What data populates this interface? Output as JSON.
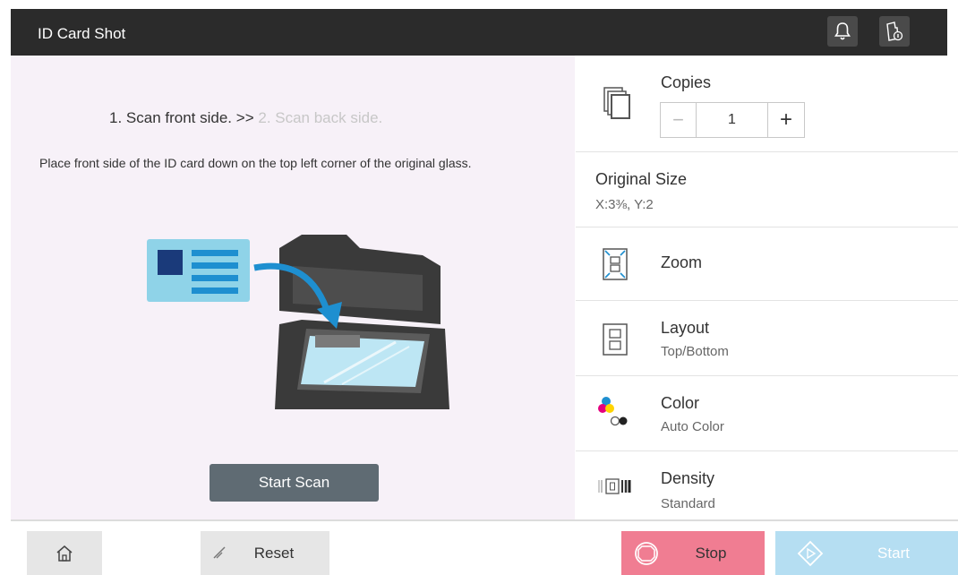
{
  "header": {
    "title": "ID Card Shot",
    "bell_icon": "bell-icon",
    "status_icon": "device-status-icon"
  },
  "left": {
    "step1": "1. Scan front side.",
    "separator": ">>",
    "step2": "2. Scan back side.",
    "instruction": "Place front side of the ID card down on the top left corner of the original glass.",
    "start_scan_label": "Start Scan"
  },
  "right": {
    "copies": {
      "label": "Copies",
      "value": "1",
      "minus": "−",
      "plus": "+"
    },
    "original_size": {
      "label": "Original Size",
      "value": "X:3⅜, Y:2"
    },
    "zoom": {
      "label": "Zoom"
    },
    "layout": {
      "label": "Layout",
      "value": "Top/Bottom"
    },
    "color": {
      "label": "Color",
      "value": "Auto Color"
    },
    "density": {
      "label": "Density",
      "value": "Standard"
    }
  },
  "bottom": {
    "reset_label": "Reset",
    "stop_label": "Stop",
    "start_label": "Start"
  },
  "colors": {
    "header_bg": "#2b2b2b",
    "left_bg": "#f7f1f8",
    "start_scan_bg": "#5f6b73",
    "stop_bg": "#f07d92",
    "start_bg": "#b5def2",
    "card_bg": "#8fd3e8",
    "card_accent": "#1a3a7a",
    "arrow": "#1e8fd0"
  }
}
